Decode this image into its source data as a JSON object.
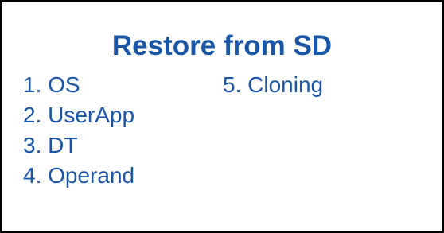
{
  "screen": {
    "title": "Restore from SD",
    "accent_color": "#1a56a8",
    "menu": {
      "left_column": [
        {
          "label": "1. OS"
        },
        {
          "label": "2. UserApp"
        },
        {
          "label": "3. DT"
        },
        {
          "label": "4. Operand"
        }
      ],
      "right_column": [
        {
          "label": "5. Cloning"
        }
      ]
    }
  }
}
